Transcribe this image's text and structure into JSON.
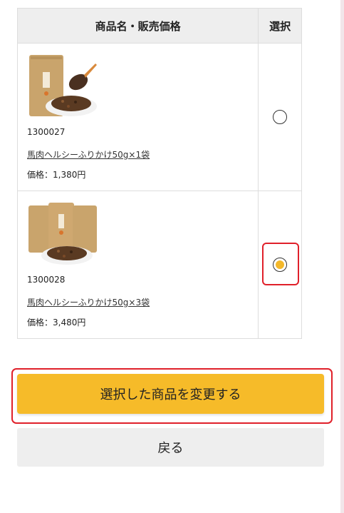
{
  "table": {
    "header_name_price": "商品名・販売価格",
    "header_select": "選択"
  },
  "products": [
    {
      "code": "1300027",
      "name": "馬肉ヘルシーふりかけ50g×1袋",
      "price": "価格：1,380円",
      "selected": false,
      "image": "product-1-pack-image"
    },
    {
      "code": "1300028",
      "name": "馬肉ヘルシーふりかけ50g×3袋",
      "price": "価格：3,480円",
      "selected": true,
      "image": "product-3-pack-image"
    }
  ],
  "buttons": {
    "change_label": "選択した商品を変更する",
    "back_label": "戻る"
  },
  "colors": {
    "accent": "#f6bb29",
    "highlight": "#e0202a",
    "header_bg": "#eeeeee"
  }
}
